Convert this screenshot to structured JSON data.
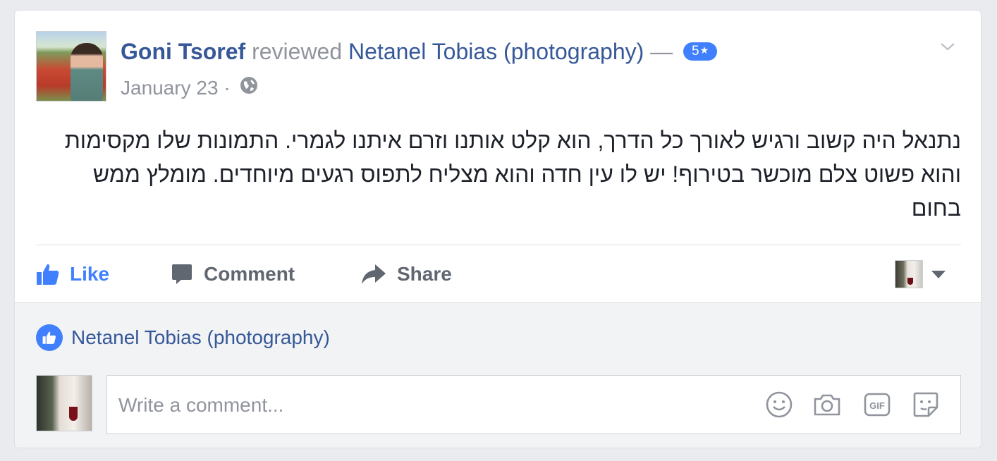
{
  "post": {
    "author": "Goni Tsoref",
    "verb": "reviewed",
    "page": "Netanel Tobias (photography)",
    "dash": "—",
    "rating": "5",
    "rating_star": "★",
    "date": "January 23",
    "date_separator": "·",
    "privacy_icon": "globe-icon",
    "review_text": "נתנאל היה קשוב ורגיש לאורך כל הדרך, הוא קלט אותנו וזרם איתנו לגמרי. התמונות שלו מקסימות והוא פשוט צלם מוכשר בטירוף! יש לו עין חדה והוא מצליח לתפוס רגעים מיוחדים. מומלץ ממש בחום"
  },
  "actions": {
    "like": "Like",
    "comment": "Comment",
    "share": "Share"
  },
  "likes": {
    "page": "Netanel Tobias (photography)"
  },
  "comment_box": {
    "placeholder": "Write a comment..."
  },
  "colors": {
    "link": "#365899",
    "accent": "#4080ff",
    "muted": "#90949c",
    "text": "#1d2129"
  }
}
